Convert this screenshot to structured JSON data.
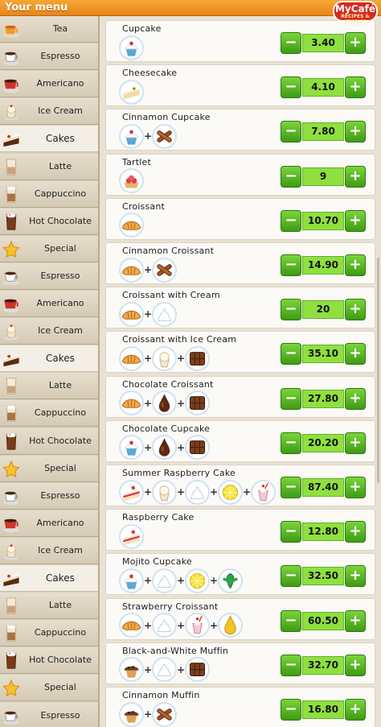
{
  "header": {
    "title": "Your menu",
    "logo_text": "MyCafé",
    "logo_sub": "RECIPES & STORIES"
  },
  "sidebar": {
    "items": [
      {
        "label": "Tea",
        "icon": "tea-cup-icon"
      },
      {
        "label": "Espresso",
        "icon": "espresso-cup-icon"
      },
      {
        "label": "Americano",
        "icon": "americano-cup-icon"
      },
      {
        "label": "Ice Cream",
        "icon": "ice-cream-cup-icon"
      },
      {
        "label": "Cakes",
        "icon": "cake-slice-icon",
        "active": true
      },
      {
        "label": "Latte",
        "icon": "latte-glass-icon"
      },
      {
        "label": "Cappuccino",
        "icon": "cappuccino-glass-icon"
      },
      {
        "label": "Hot Chocolate",
        "icon": "hot-chocolate-glass-icon"
      },
      {
        "label": "Special",
        "icon": "special-star-icon"
      },
      {
        "label": "Espresso",
        "icon": "espresso-cup-icon"
      },
      {
        "label": "Americano",
        "icon": "americano-cup-icon"
      },
      {
        "label": "Ice Cream",
        "icon": "ice-cream-cup-icon"
      },
      {
        "label": "Cakes",
        "icon": "cake-slice-icon",
        "active": true
      },
      {
        "label": "Latte",
        "icon": "latte-glass-icon"
      },
      {
        "label": "Cappuccino",
        "icon": "cappuccino-glass-icon"
      },
      {
        "label": "Hot Chocolate",
        "icon": "hot-chocolate-glass-icon"
      },
      {
        "label": "Special",
        "icon": "special-star-icon"
      },
      {
        "label": "Espresso",
        "icon": "espresso-cup-icon"
      },
      {
        "label": "Americano",
        "icon": "americano-cup-icon"
      },
      {
        "label": "Ice Cream",
        "icon": "ice-cream-cup-icon"
      },
      {
        "label": "Cakes",
        "icon": "cake-slice-icon",
        "active": true
      },
      {
        "label": "Latte",
        "icon": "latte-glass-icon"
      },
      {
        "label": "Cappuccino",
        "icon": "cappuccino-glass-icon"
      },
      {
        "label": "Hot Chocolate",
        "icon": "hot-chocolate-glass-icon"
      },
      {
        "label": "Special",
        "icon": "special-star-icon"
      },
      {
        "label": "Espresso",
        "icon": "espresso-cup-icon"
      }
    ]
  },
  "menu": {
    "items": [
      {
        "name": "Cupcake",
        "price": "3.40",
        "ingredients": [
          "cupcake"
        ]
      },
      {
        "name": "Cheesecake",
        "price": "4.10",
        "ingredients": [
          "cheesecake"
        ]
      },
      {
        "name": "Cinnamon Cupcake",
        "price": "7.80",
        "ingredients": [
          "cupcake",
          "cinnamon"
        ]
      },
      {
        "name": "Tartlet",
        "price": "9",
        "ingredients": [
          "tartlet"
        ]
      },
      {
        "name": "Croissant",
        "price": "10.70",
        "ingredients": [
          "croissant"
        ]
      },
      {
        "name": "Cinnamon Croissant",
        "price": "14.90",
        "ingredients": [
          "croissant",
          "cinnamon"
        ]
      },
      {
        "name": "Croissant with Cream",
        "price": "20",
        "ingredients": [
          "croissant",
          "whipped-cream"
        ]
      },
      {
        "name": "Croissant with Ice Cream",
        "price": "35.10",
        "ingredients": [
          "croissant",
          "ice-cream",
          "chocolate-bar"
        ]
      },
      {
        "name": "Chocolate Croissant",
        "price": "27.80",
        "ingredients": [
          "croissant",
          "chocolate-syrup",
          "chocolate-bar"
        ]
      },
      {
        "name": "Chocolate Cupcake",
        "price": "20.20",
        "ingredients": [
          "cupcake",
          "chocolate-syrup",
          "chocolate-bar"
        ]
      },
      {
        "name": "Summer Raspberry Cake",
        "price": "87.40",
        "ingredients": [
          "raspberry-cake",
          "ice-cream",
          "whipped-cream",
          "lemon",
          "milkshake"
        ]
      },
      {
        "name": "Raspberry Cake",
        "price": "12.80",
        "ingredients": [
          "raspberry-cake"
        ]
      },
      {
        "name": "Mojito Cupcake",
        "price": "32.50",
        "ingredients": [
          "cupcake",
          "whipped-cream",
          "lemon",
          "mint"
        ]
      },
      {
        "name": "Strawberry Croissant",
        "price": "60.50",
        "ingredients": [
          "croissant",
          "whipped-cream",
          "milkshake",
          "syrup"
        ]
      },
      {
        "name": "Black-and-White Muffin",
        "price": "32.70",
        "ingredients": [
          "muffin",
          "whipped-cream",
          "chocolate-bar"
        ]
      },
      {
        "name": "Cinnamon Muffin",
        "price": "16.80",
        "ingredients": [
          "muffin",
          "cinnamon"
        ]
      }
    ],
    "minus_label": "−",
    "plus_label": "+",
    "separator": "+"
  },
  "colors": {
    "accent_orange": "#f39a2b",
    "button_green": "#5cb82a",
    "price_green": "#8fe03f"
  }
}
